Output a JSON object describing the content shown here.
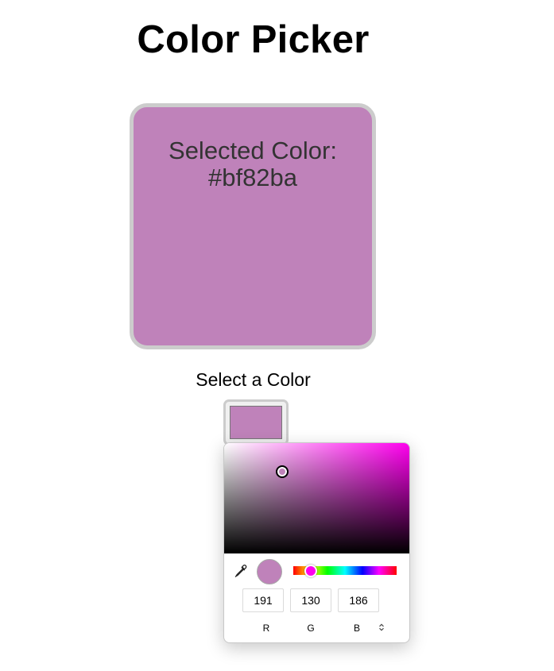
{
  "page": {
    "title": "Color Picker"
  },
  "preview": {
    "label": "Selected Color:",
    "hex": "#bf82ba",
    "color": "#bf82ba"
  },
  "selector": {
    "label": "Select a Color",
    "swatch_color": "#bf82ba"
  },
  "picker": {
    "hue_color": "#ff00ee",
    "current_color": "#bf82ba",
    "eyedropper_icon": "eyedropper-icon",
    "mode_toggle_icon": "chevron-up-down-icon",
    "channels": [
      {
        "value": "191",
        "label": "R"
      },
      {
        "value": "130",
        "label": "G"
      },
      {
        "value": "186",
        "label": "B"
      }
    ]
  }
}
